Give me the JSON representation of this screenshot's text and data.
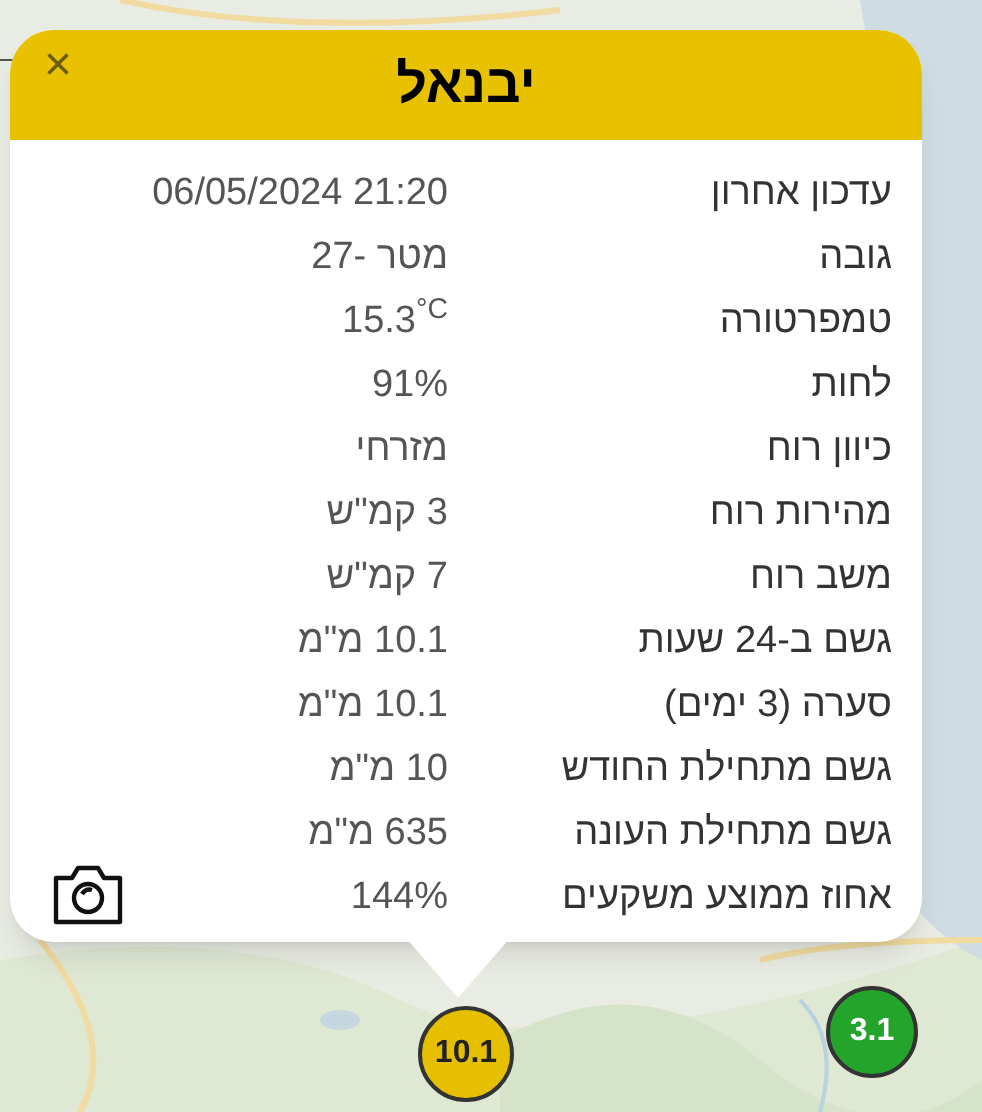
{
  "popup": {
    "title": "יבנאל",
    "close": "×",
    "rows": [
      {
        "label": "עדכון אחרון",
        "value": "06/05/2024 21:20"
      },
      {
        "label": "גובה",
        "value": "מטר -27"
      },
      {
        "label": "טמפרטורה",
        "value": "15.3$^{°C}$"
      },
      {
        "label": "לחות",
        "value": "91%"
      },
      {
        "label": "כיוון רוח",
        "value": "מזרחי"
      },
      {
        "label": "מהירות רוח",
        "value": "3 קמ\"ש"
      },
      {
        "label": "משב רוח",
        "value": "7 קמ\"ש"
      },
      {
        "label": "גשם ב-24 שעות",
        "value": "10.1 מ\"מ"
      },
      {
        "label": "סערה (3 ימים)",
        "value": "10.1 מ\"מ"
      },
      {
        "label": "גשם מתחילת החודש",
        "value": "10 מ\"מ"
      },
      {
        "label": "גשם מתחילת העונה",
        "value": "635 מ\"מ"
      },
      {
        "label": "אחוז ממוצע משקעים",
        "value": "144%"
      }
    ]
  },
  "markers": [
    {
      "value": "10.1",
      "color": "#e6c000"
    },
    {
      "value": "3.1",
      "color": "#22a52a"
    }
  ]
}
